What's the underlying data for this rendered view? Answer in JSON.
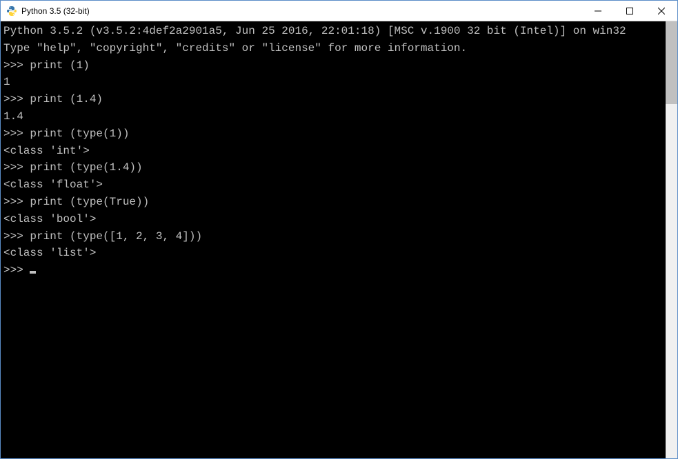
{
  "window": {
    "title": "Python 3.5 (32-bit)"
  },
  "console": {
    "header_line1": "Python 3.5.2 (v3.5.2:4def2a2901a5, Jun 25 2016, 22:01:18) [MSC v.1900 32 bit (Intel)] on win32",
    "header_line2": "Type \"help\", \"copyright\", \"credits\" or \"license\" for more information.",
    "prompt": ">>> ",
    "entries": [
      {
        "input": "print (1)",
        "output": "1"
      },
      {
        "input": "print (1.4)",
        "output": "1.4"
      },
      {
        "input": "print (type(1))",
        "output": "<class 'int'>"
      },
      {
        "input": "print (type(1.4))",
        "output": "<class 'float'>"
      },
      {
        "input": "print (type(True))",
        "output": "<class 'bool'>"
      },
      {
        "input": "print (type([1, 2, 3, 4]))",
        "output": "<class 'list'>"
      }
    ]
  }
}
